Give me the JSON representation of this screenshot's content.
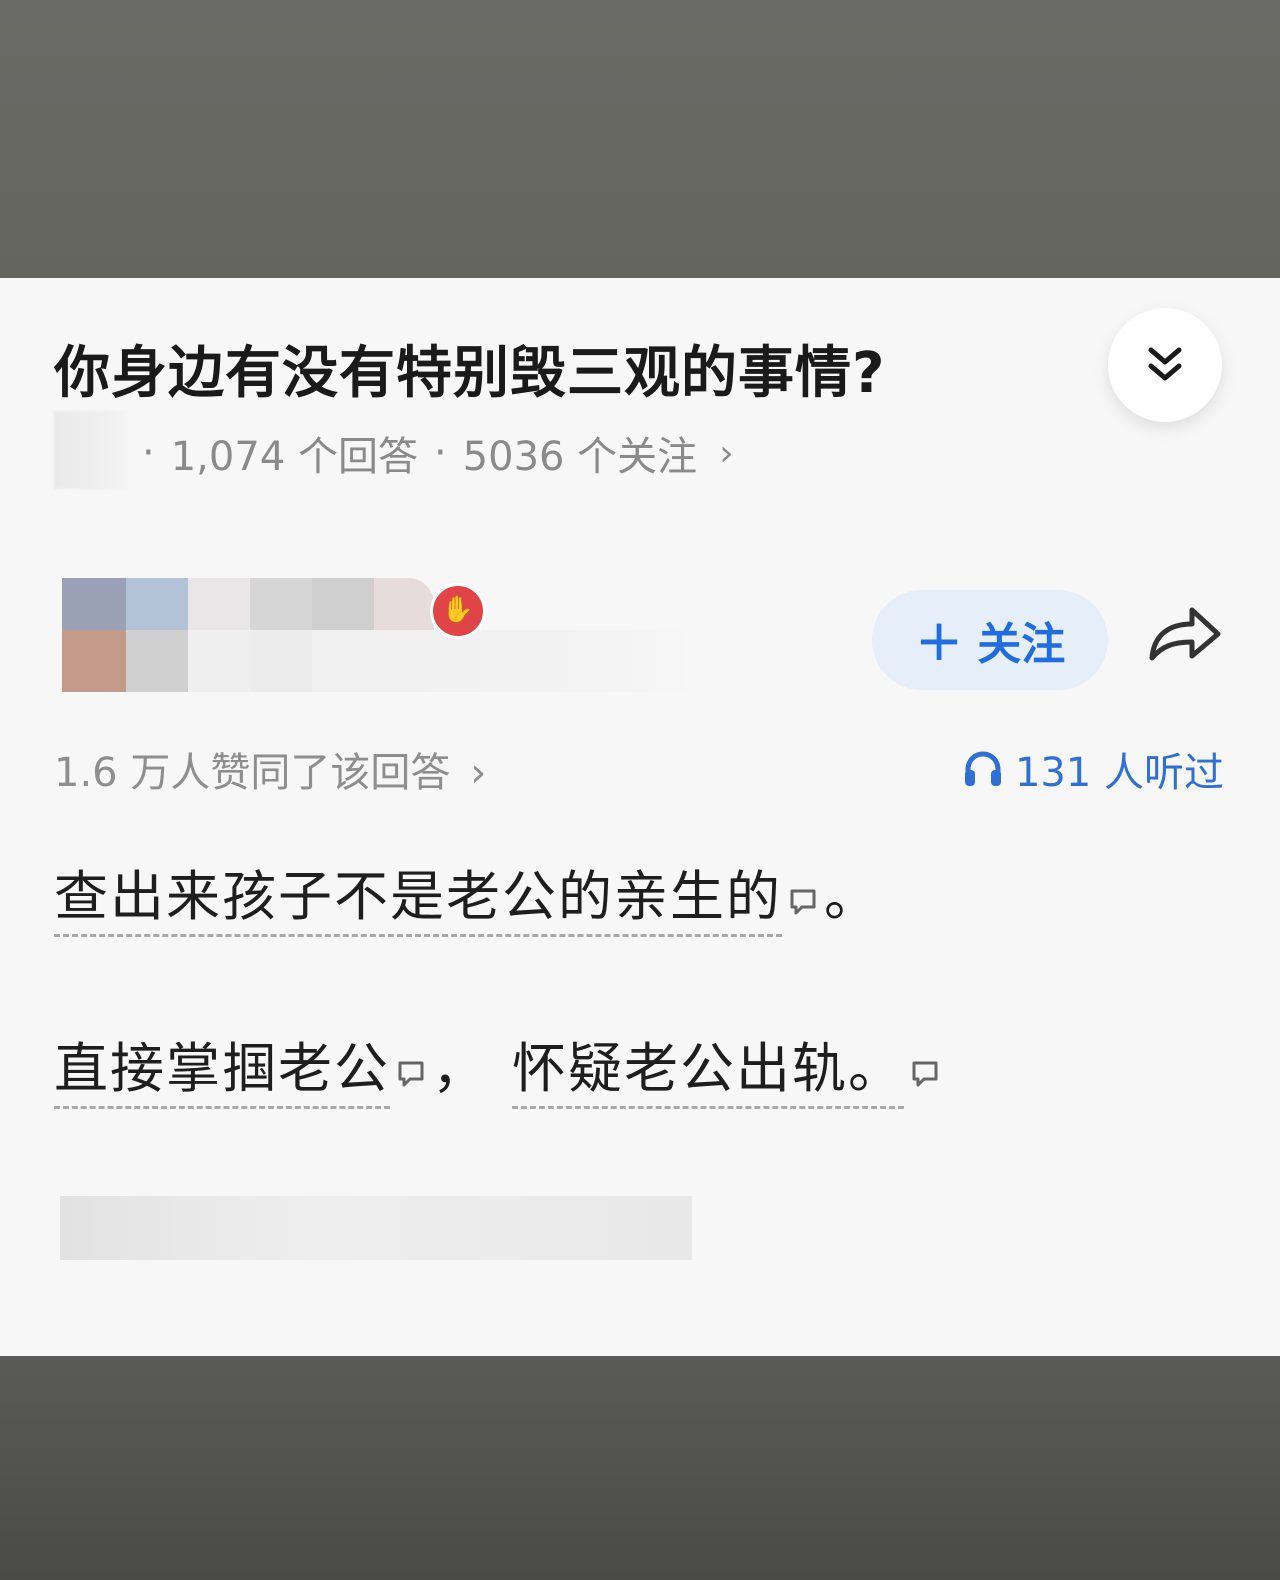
{
  "question": {
    "title": "你身边有没有特别毁三观的事情?",
    "answers_count": "1,074 个回答",
    "followers_count": "5036 个关注",
    "chevron": "›"
  },
  "icons": {
    "collapse": "double-chevron-down-icon",
    "share": "share-arrow-icon",
    "headphones": "headphones-icon",
    "comment": "comment-bubble-icon",
    "like_badge": "thumbs-up-badge-icon"
  },
  "author": {
    "follow_plus": "+",
    "follow_label": "关注"
  },
  "stats": {
    "upvotes": "1.6 万人赞同了该回答",
    "chevron": "›",
    "listens": "131 人听过"
  },
  "answer": {
    "line1_text": "查出来孩子不是老公的亲生的",
    "line1_tail": "。",
    "line2_part1": "直接掌掴老公",
    "line2_comma": "，",
    "line2_part2": "怀疑老公出轨。"
  },
  "colors": {
    "accent": "#1f6de0",
    "follow_bg": "#e6eef9",
    "badge_red": "#e04446"
  }
}
